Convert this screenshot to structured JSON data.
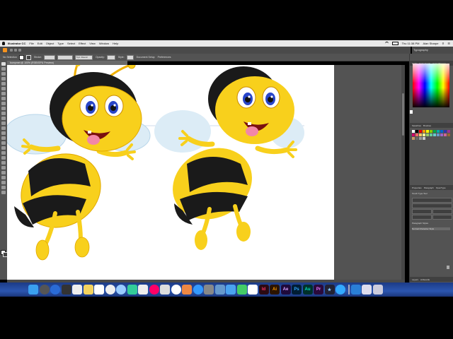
{
  "menubar": {
    "items": [
      "Illustrator CC",
      "File",
      "Edit",
      "Object",
      "Type",
      "Select",
      "Effect",
      "View",
      "Window",
      "Help"
    ],
    "clock": "Thu 11:38 PM",
    "user": "Alan Sharpe"
  },
  "control_bar": {
    "selection_label": "No Selection",
    "stroke_label": "Stroke:",
    "brush_value": "5 pt. Round",
    "opacity_label": "Opacity:",
    "style_label": "Style:",
    "doc_setup_label": "Document Setup",
    "preferences_label": "Preferences"
  },
  "workspace": "Typography",
  "document_tab": "bumpmet @ 100% (RGB/GPU Preview)",
  "panels": {
    "color_tabs": [
      "Color",
      "Color Guide",
      "Color Themes"
    ],
    "swatches_tabs": [
      "Swatches",
      "Brushes"
    ],
    "properties_tabs": [
      "Properties",
      "Paragraph",
      "OpenType"
    ],
    "layers_tabs": [
      "Layers",
      "Artboards"
    ],
    "char_style": "Touch Type Tool",
    "para_label": "Paragraph Styles",
    "default_style": "Normal Character Style"
  },
  "colors": {
    "ui_dark": "#535353",
    "bee_yellow": "#f8d01c",
    "bee_black": "#1a1a1a",
    "wing": "#dcecf6",
    "dock_blue": "#2b56b0"
  }
}
